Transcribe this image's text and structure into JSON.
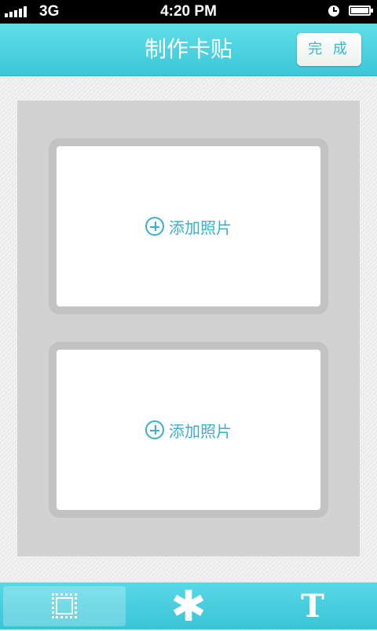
{
  "status_bar": {
    "carrier": "3G",
    "time": "4:20 PM",
    "icons": [
      "signal-icon",
      "clock-icon",
      "battery-icon"
    ]
  },
  "nav": {
    "title": "制作卡贴",
    "done_label": "完 成"
  },
  "slots": [
    {
      "label": "添加照片",
      "icon": "plus-circle-icon"
    },
    {
      "label": "添加照片",
      "icon": "plus-circle-icon"
    }
  ],
  "toolbar": {
    "tools": [
      {
        "icon": "stamp-frame-icon",
        "glyph": ""
      },
      {
        "icon": "asterisk-icon",
        "glyph": "✱"
      },
      {
        "icon": "text-icon",
        "glyph": "T"
      }
    ]
  },
  "colors": {
    "accent": "#45cfdf",
    "link": "#3aaecd",
    "canvas": "#d2d2d2"
  }
}
